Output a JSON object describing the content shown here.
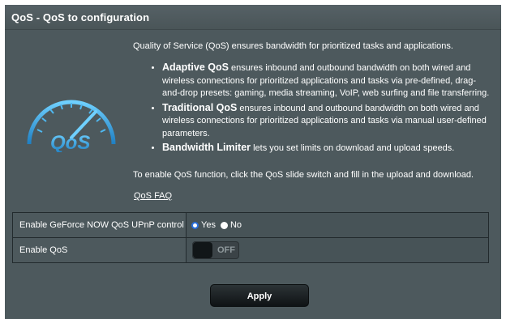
{
  "header": {
    "title": "QoS - QoS to configuration"
  },
  "logo": {
    "icon": "qos-speedometer-icon",
    "text": "QoS",
    "color": "#3aa7e6"
  },
  "intro": {
    "lead": "Quality of Service (QoS) ensures bandwidth for prioritized tasks and applications.",
    "bullets": [
      {
        "term": "Adaptive QoS",
        "desc": " ensures inbound and outbound bandwidth on both wired and wireless connections for prioritized applications and tasks via pre-defined, drag-and-drop presets: gaming, media streaming, VoIP, web surfing and file transferring."
      },
      {
        "term": "Traditional QoS",
        "desc": " ensures inbound and outbound bandwidth on both wired and wireless connections for prioritized applications and tasks via manual user-defined parameters."
      },
      {
        "term": "Bandwidth Limiter",
        "desc": " lets you set limits on download and upload speeds."
      }
    ],
    "enable_note": "To enable QoS function, click the QoS slide switch and fill in the upload and download.",
    "faq_link": "QoS FAQ"
  },
  "settings": {
    "geforce": {
      "label": "Enable GeForce NOW QoS UPnP control",
      "yes": "Yes",
      "no": "No",
      "selected": "Yes"
    },
    "enable_qos": {
      "label": "Enable QoS",
      "switch_state": "OFF"
    }
  },
  "apply_label": "Apply"
}
